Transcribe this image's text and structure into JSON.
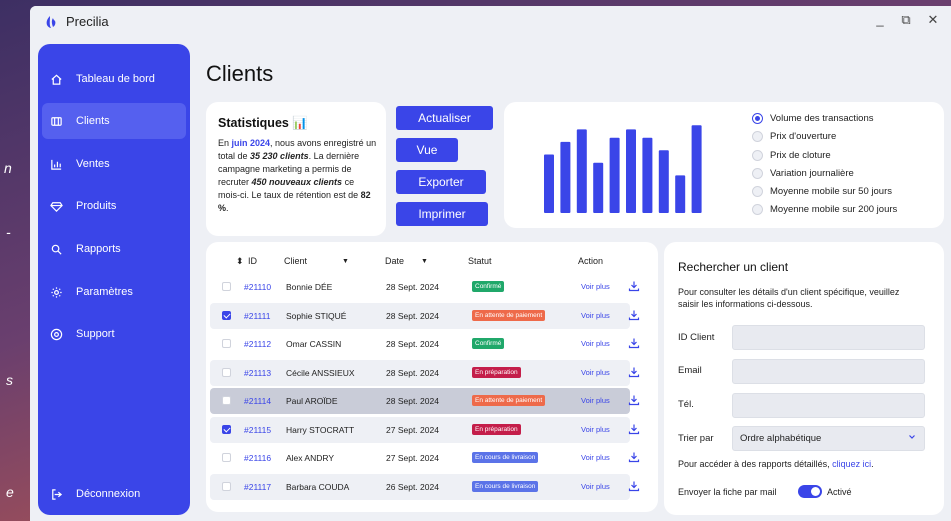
{
  "window": {
    "app_title": "Precilia",
    "controls": {
      "minimize": "_",
      "restore": "⧉",
      "close": "✕"
    }
  },
  "background_fragments": [
    "n",
    "-",
    "s",
    "e"
  ],
  "sidebar": {
    "items": [
      {
        "label": "Tableau de bord",
        "icon": "home-icon"
      },
      {
        "label": "Clients",
        "icon": "clients-icon",
        "active": true
      },
      {
        "label": "Ventes",
        "icon": "bar-chart-icon"
      },
      {
        "label": "Produits",
        "icon": "diamond-icon"
      },
      {
        "label": "Rapports",
        "icon": "search-icon"
      },
      {
        "label": "Paramètres",
        "icon": "gear-icon"
      },
      {
        "label": "Support",
        "icon": "support-icon"
      }
    ],
    "logout": "Déconnexion"
  },
  "page_title": "Clients",
  "stats": {
    "title": "Statistiques 📊",
    "t1": "En ",
    "month": "juin 2024",
    "t2": ", nous avons enregistré un total de ",
    "total": "35 230 clients",
    "t3": ". La dernière campagne marketing a permis de recruter ",
    "new_clients": "450 nouveaux clients",
    "t4": " ce mois-ci. Le taux de rétention est de ",
    "rate": "82 %",
    "t5": "."
  },
  "actions": {
    "refresh": "Actualiser",
    "view": "Vue",
    "export": "Exporter",
    "print": "Imprimer"
  },
  "chart_data": {
    "type": "bar",
    "values": [
      7,
      8.5,
      10,
      6,
      9,
      10,
      9,
      7.5,
      4.5,
      10.5
    ],
    "ylim": [
      0,
      11
    ],
    "grid": false,
    "color": "#3a45e8"
  },
  "chart_options": [
    {
      "label": "Volume des transactions",
      "selected": true
    },
    {
      "label": "Prix d'ouverture"
    },
    {
      "label": "Prix de cloture"
    },
    {
      "label": "Variation journalière"
    },
    {
      "label": "Moyenne mobile sur 50 jours"
    },
    {
      "label": "Moyenne mobile sur 200 jours"
    }
  ],
  "table": {
    "headers": {
      "sort": "⬍",
      "id": "ID",
      "client": "Client",
      "client_sort": "▼",
      "date": "Date",
      "date_sort": "▼",
      "status": "Statut",
      "action": "Action"
    },
    "rows": [
      {
        "id": "#21110",
        "client": "Bonnie DÉE",
        "date": "28 Sept. 2024",
        "status": "Confirmé",
        "status_color": "#20a86a",
        "action": "Voir plus",
        "checked": false
      },
      {
        "id": "#21111",
        "client": "Sophie STIQUÉ",
        "date": "28 Sept. 2024",
        "status": "En attente de paiement",
        "status_color": "#ee6a4a",
        "action": "Voir plus",
        "checked": true
      },
      {
        "id": "#21112",
        "client": "Omar CASSIN",
        "date": "28 Sept. 2024",
        "status": "Confirmé",
        "status_color": "#20a86a",
        "action": "Voir plus",
        "checked": false
      },
      {
        "id": "#21113",
        "client": "Cécile ANSSIEUX",
        "date": "28 Sept. 2024",
        "status": "En préparation",
        "status_color": "#c41e4a",
        "action": "Voir plus",
        "checked": false
      },
      {
        "id": "#21114",
        "client": "Paul AROÏDE",
        "date": "28 Sept. 2024",
        "status": "En attente de paiement",
        "status_color": "#ee6a4a",
        "action": "Voir plus",
        "checked": false
      },
      {
        "id": "#21115",
        "client": "Harry STOCRATT",
        "date": "27 Sept. 2024",
        "status": "En préparation",
        "status_color": "#c41e4a",
        "action": "Voir plus",
        "checked": true
      },
      {
        "id": "#21116",
        "client": "Alex ANDRY",
        "date": "27 Sept. 2024",
        "status": "En cours de livraison",
        "status_color": "#5b73e8",
        "action": "Voir plus",
        "checked": false
      },
      {
        "id": "#21117",
        "client": "Barbara COUDA",
        "date": "26 Sept. 2024",
        "status": "En cours de livraison",
        "status_color": "#5b73e8",
        "action": "Voir plus",
        "checked": false
      }
    ]
  },
  "search": {
    "title": "Rechercher un client",
    "description": "Pour consulter les détails d'un client spécifique, veuillez saisir les informations ci-dessous.",
    "labels": {
      "id": "ID Client",
      "email": "Email",
      "phone": "Tél.",
      "sort": "Trier par"
    },
    "sort_value": "Ordre alphabétique",
    "report_text": "Pour accéder à des rapports détaillés, ",
    "report_link": "cliquez ici",
    "report_end": ".",
    "send_mail": "Envoyer la fiche par mail",
    "toggle_label": "Activé"
  }
}
